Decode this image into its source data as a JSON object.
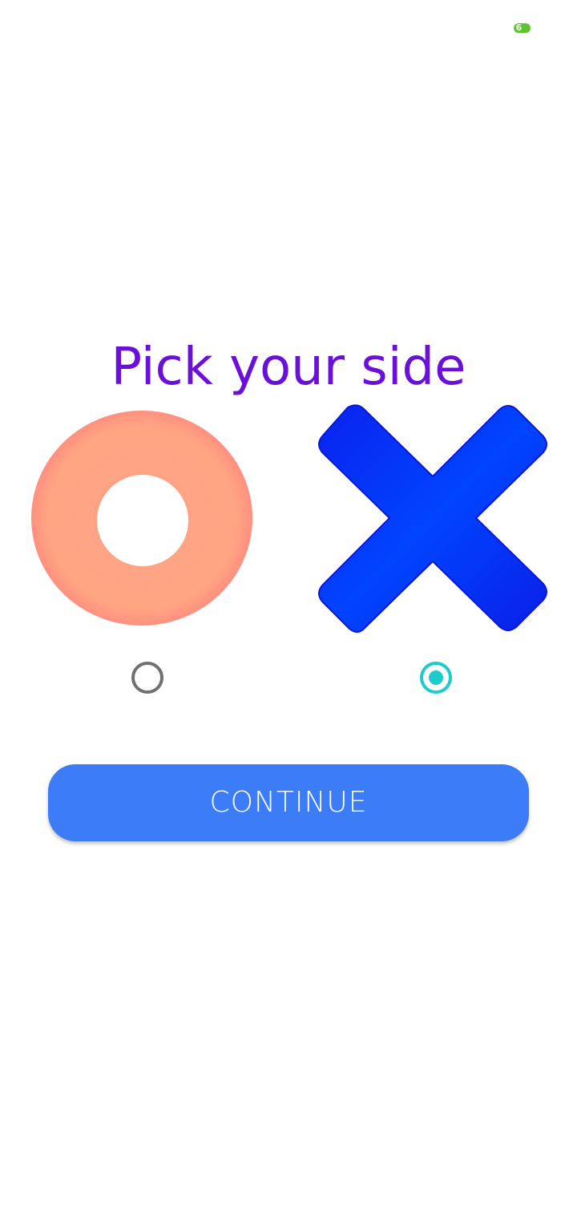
{
  "status_bar": {
    "battery_level": "6",
    "battery_color": "#5ec42e"
  },
  "screen": {
    "title": "Pick your side",
    "title_color": "#6a10d8"
  },
  "choices": [
    {
      "symbol": "O",
      "icon": "o-ring-icon",
      "color": "#ffa582",
      "selected": false
    },
    {
      "symbol": "X",
      "icon": "x-cross-icon",
      "color": "#0044ff",
      "selected": true
    }
  ],
  "radio_colors": {
    "unselected": "#707070",
    "selected": "#1ecbcb"
  },
  "continue_button": {
    "label": "CONTINUE",
    "color": "#3c7cf6"
  }
}
